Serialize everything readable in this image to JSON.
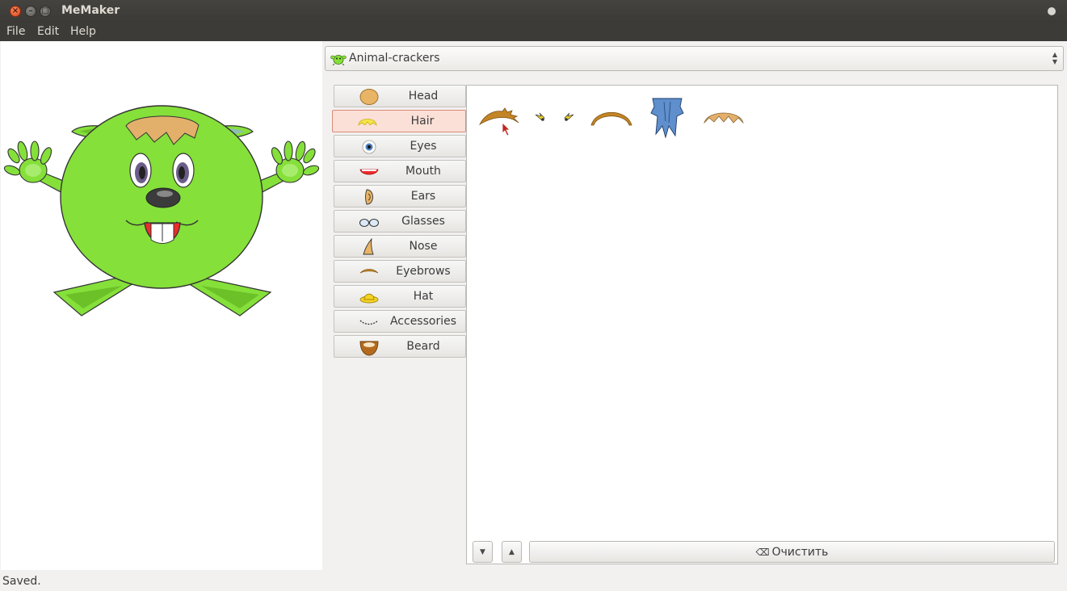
{
  "window": {
    "title": "MeMaker"
  },
  "menu": {
    "file": "File",
    "edit": "Edit",
    "help": "Help"
  },
  "theme_selector": {
    "selected": "Animal-crackers",
    "icon": "green-monster-icon"
  },
  "categories": [
    {
      "label": "Head",
      "icon": "head-icon",
      "active": false
    },
    {
      "label": "Hair",
      "icon": "hair-icon",
      "active": true
    },
    {
      "label": "Eyes",
      "icon": "eye-icon",
      "active": false
    },
    {
      "label": "Mouth",
      "icon": "mouth-icon",
      "active": false
    },
    {
      "label": "Ears",
      "icon": "ear-icon",
      "active": false
    },
    {
      "label": "Glasses",
      "icon": "glasses-icon",
      "active": false
    },
    {
      "label": "Nose",
      "icon": "nose-icon",
      "active": false
    },
    {
      "label": "Eyebrows",
      "icon": "eyebrow-icon",
      "active": false
    },
    {
      "label": "Hat",
      "icon": "hat-icon",
      "active": false
    },
    {
      "label": "Accessories",
      "icon": "accessories-icon",
      "active": false
    },
    {
      "label": "Beard",
      "icon": "beard-icon",
      "active": false
    }
  ],
  "hair_options": [
    "brown-spiky-hair",
    "small-yellow-tuft-left",
    "small-yellow-tuft-right",
    "brown-arched-hair",
    "blue-shaggy-hair",
    "tan-bangs-hair"
  ],
  "buttons": {
    "scroll_down_icon": "arrow-down-icon",
    "scroll_up_icon": "arrow-up-icon",
    "clear_label": "Очистить",
    "clear_icon": "clear-icon"
  },
  "status": {
    "text": "Saved."
  },
  "colors": {
    "body_green": "#85e03a",
    "active_highlight": "#fbe0d8",
    "titlebar": "#3c3b37"
  }
}
